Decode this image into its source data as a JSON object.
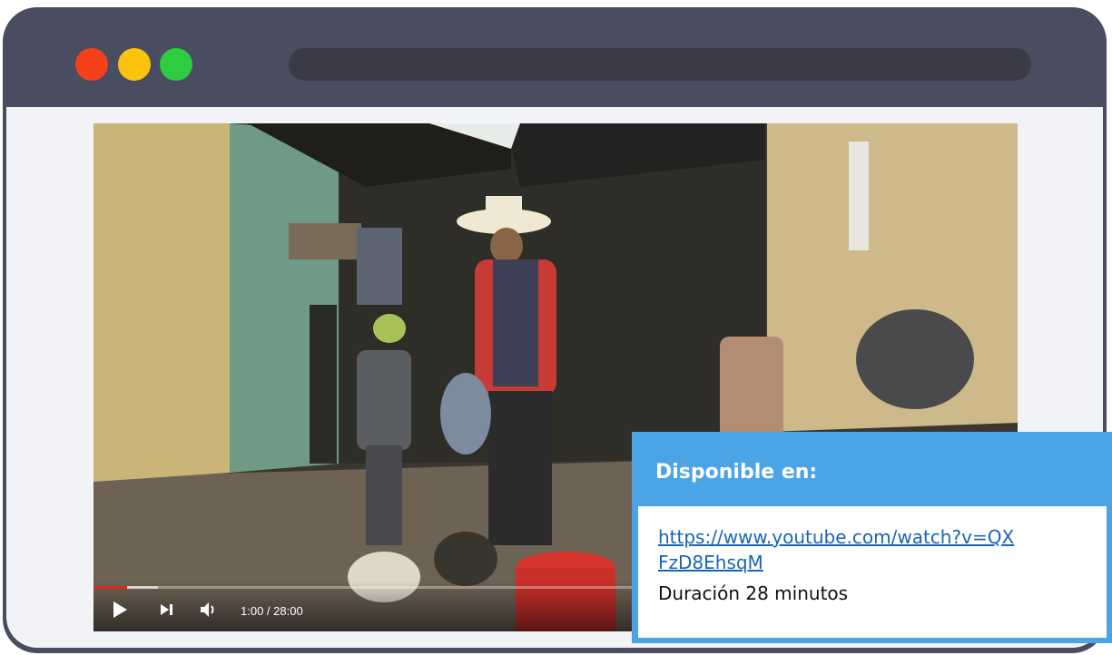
{
  "window": {
    "controls": [
      "close",
      "minimize",
      "maximize"
    ],
    "colors": {
      "frame": "#4a4c5f",
      "close": "#f4411b",
      "minimize": "#fcc30d",
      "maximize": "#2ecc3f"
    }
  },
  "video": {
    "time_display": "1:00 / 28:00",
    "progress_played": 0.036,
    "progress_buffered": 0.07,
    "icons": [
      "play-icon",
      "next-icon",
      "volume-icon"
    ]
  },
  "info_card": {
    "title": "Disponible en:",
    "link_text": "https://www.youtube.com/watch?v=QXFzD8EhsqM",
    "duration": "Duración 28 minutos",
    "accent_color": "#4aa4e6"
  }
}
